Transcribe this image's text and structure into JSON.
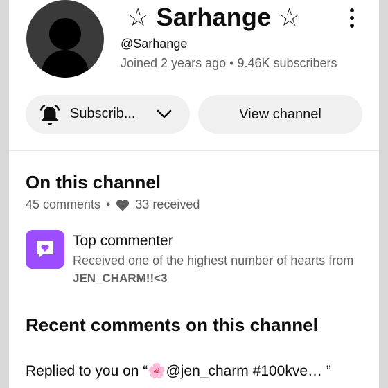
{
  "channel": {
    "name": "☆ Sarhange ☆",
    "handle": "@Sarhange",
    "joined": "Joined 2 years ago",
    "separator": "•",
    "subscribers": "9.46K subscribers"
  },
  "actions": {
    "subscribe_label": "Subscrib...",
    "view_channel_label": "View channel"
  },
  "on_channel": {
    "title": "On this channel",
    "comments": "45 comments",
    "separator": "•",
    "received": "33 received"
  },
  "top_commenter": {
    "title": "Top commenter",
    "description": "Received one of the highest number of hearts from",
    "from_user": "JEN_CHARM!!<3"
  },
  "recent": {
    "title": "Recent comments on this channel",
    "reply_prefix": "Replied to you on “",
    "reply_flower": "🌸",
    "reply_video": "@jen_charm #100kve…",
    "reply_suffix": " ”"
  },
  "icons": {
    "more": "kebab-menu-icon",
    "bell": "bell-icon",
    "chevron": "chevron-down-icon",
    "heart": "heart-icon",
    "badge": "heart-message-icon"
  },
  "colors": {
    "badge": "#9b4dff",
    "pill": "#f0f0f0",
    "secondary_text": "#606060"
  }
}
